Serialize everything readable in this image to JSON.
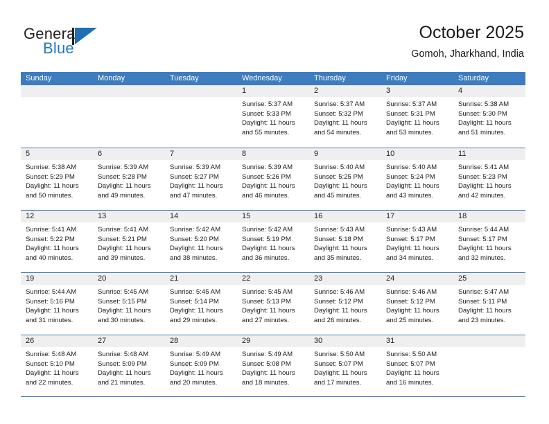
{
  "brand": {
    "name_part1": "General",
    "name_part2": "Blue",
    "flag_icon": "blue-flag-triangle"
  },
  "header": {
    "title": "October 2025",
    "subtitle": "Gomoh, Jharkhand, India"
  },
  "colors": {
    "header_blue": "#3d7cbf",
    "band_gray": "#efefef",
    "brand_blue": "#1f7ac4",
    "text_dark": "#1a1a1a"
  },
  "weekdays": [
    "Sunday",
    "Monday",
    "Tuesday",
    "Wednesday",
    "Thursday",
    "Friday",
    "Saturday"
  ],
  "labels": {
    "sunrise_prefix": "Sunrise: ",
    "sunset_prefix": "Sunset: ",
    "daylight_prefix": "Daylight: "
  },
  "weeks": [
    [
      {
        "day": "",
        "empty": true
      },
      {
        "day": "",
        "empty": true
      },
      {
        "day": "",
        "empty": true
      },
      {
        "day": "1",
        "sunrise": "Sunrise: 5:37 AM",
        "sunset": "Sunset: 5:33 PM",
        "daylight_l1": "Daylight: 11 hours",
        "daylight_l2": "and 55 minutes."
      },
      {
        "day": "2",
        "sunrise": "Sunrise: 5:37 AM",
        "sunset": "Sunset: 5:32 PM",
        "daylight_l1": "Daylight: 11 hours",
        "daylight_l2": "and 54 minutes."
      },
      {
        "day": "3",
        "sunrise": "Sunrise: 5:37 AM",
        "sunset": "Sunset: 5:31 PM",
        "daylight_l1": "Daylight: 11 hours",
        "daylight_l2": "and 53 minutes."
      },
      {
        "day": "4",
        "sunrise": "Sunrise: 5:38 AM",
        "sunset": "Sunset: 5:30 PM",
        "daylight_l1": "Daylight: 11 hours",
        "daylight_l2": "and 51 minutes."
      }
    ],
    [
      {
        "day": "5",
        "sunrise": "Sunrise: 5:38 AM",
        "sunset": "Sunset: 5:29 PM",
        "daylight_l1": "Daylight: 11 hours",
        "daylight_l2": "and 50 minutes."
      },
      {
        "day": "6",
        "sunrise": "Sunrise: 5:39 AM",
        "sunset": "Sunset: 5:28 PM",
        "daylight_l1": "Daylight: 11 hours",
        "daylight_l2": "and 49 minutes."
      },
      {
        "day": "7",
        "sunrise": "Sunrise: 5:39 AM",
        "sunset": "Sunset: 5:27 PM",
        "daylight_l1": "Daylight: 11 hours",
        "daylight_l2": "and 47 minutes."
      },
      {
        "day": "8",
        "sunrise": "Sunrise: 5:39 AM",
        "sunset": "Sunset: 5:26 PM",
        "daylight_l1": "Daylight: 11 hours",
        "daylight_l2": "and 46 minutes."
      },
      {
        "day": "9",
        "sunrise": "Sunrise: 5:40 AM",
        "sunset": "Sunset: 5:25 PM",
        "daylight_l1": "Daylight: 11 hours",
        "daylight_l2": "and 45 minutes."
      },
      {
        "day": "10",
        "sunrise": "Sunrise: 5:40 AM",
        "sunset": "Sunset: 5:24 PM",
        "daylight_l1": "Daylight: 11 hours",
        "daylight_l2": "and 43 minutes."
      },
      {
        "day": "11",
        "sunrise": "Sunrise: 5:41 AM",
        "sunset": "Sunset: 5:23 PM",
        "daylight_l1": "Daylight: 11 hours",
        "daylight_l2": "and 42 minutes."
      }
    ],
    [
      {
        "day": "12",
        "sunrise": "Sunrise: 5:41 AM",
        "sunset": "Sunset: 5:22 PM",
        "daylight_l1": "Daylight: 11 hours",
        "daylight_l2": "and 40 minutes."
      },
      {
        "day": "13",
        "sunrise": "Sunrise: 5:41 AM",
        "sunset": "Sunset: 5:21 PM",
        "daylight_l1": "Daylight: 11 hours",
        "daylight_l2": "and 39 minutes."
      },
      {
        "day": "14",
        "sunrise": "Sunrise: 5:42 AM",
        "sunset": "Sunset: 5:20 PM",
        "daylight_l1": "Daylight: 11 hours",
        "daylight_l2": "and 38 minutes."
      },
      {
        "day": "15",
        "sunrise": "Sunrise: 5:42 AM",
        "sunset": "Sunset: 5:19 PM",
        "daylight_l1": "Daylight: 11 hours",
        "daylight_l2": "and 36 minutes."
      },
      {
        "day": "16",
        "sunrise": "Sunrise: 5:43 AM",
        "sunset": "Sunset: 5:18 PM",
        "daylight_l1": "Daylight: 11 hours",
        "daylight_l2": "and 35 minutes."
      },
      {
        "day": "17",
        "sunrise": "Sunrise: 5:43 AM",
        "sunset": "Sunset: 5:17 PM",
        "daylight_l1": "Daylight: 11 hours",
        "daylight_l2": "and 34 minutes."
      },
      {
        "day": "18",
        "sunrise": "Sunrise: 5:44 AM",
        "sunset": "Sunset: 5:17 PM",
        "daylight_l1": "Daylight: 11 hours",
        "daylight_l2": "and 32 minutes."
      }
    ],
    [
      {
        "day": "19",
        "sunrise": "Sunrise: 5:44 AM",
        "sunset": "Sunset: 5:16 PM",
        "daylight_l1": "Daylight: 11 hours",
        "daylight_l2": "and 31 minutes."
      },
      {
        "day": "20",
        "sunrise": "Sunrise: 5:45 AM",
        "sunset": "Sunset: 5:15 PM",
        "daylight_l1": "Daylight: 11 hours",
        "daylight_l2": "and 30 minutes."
      },
      {
        "day": "21",
        "sunrise": "Sunrise: 5:45 AM",
        "sunset": "Sunset: 5:14 PM",
        "daylight_l1": "Daylight: 11 hours",
        "daylight_l2": "and 29 minutes."
      },
      {
        "day": "22",
        "sunrise": "Sunrise: 5:45 AM",
        "sunset": "Sunset: 5:13 PM",
        "daylight_l1": "Daylight: 11 hours",
        "daylight_l2": "and 27 minutes."
      },
      {
        "day": "23",
        "sunrise": "Sunrise: 5:46 AM",
        "sunset": "Sunset: 5:12 PM",
        "daylight_l1": "Daylight: 11 hours",
        "daylight_l2": "and 26 minutes."
      },
      {
        "day": "24",
        "sunrise": "Sunrise: 5:46 AM",
        "sunset": "Sunset: 5:12 PM",
        "daylight_l1": "Daylight: 11 hours",
        "daylight_l2": "and 25 minutes."
      },
      {
        "day": "25",
        "sunrise": "Sunrise: 5:47 AM",
        "sunset": "Sunset: 5:11 PM",
        "daylight_l1": "Daylight: 11 hours",
        "daylight_l2": "and 23 minutes."
      }
    ],
    [
      {
        "day": "26",
        "sunrise": "Sunrise: 5:48 AM",
        "sunset": "Sunset: 5:10 PM",
        "daylight_l1": "Daylight: 11 hours",
        "daylight_l2": "and 22 minutes."
      },
      {
        "day": "27",
        "sunrise": "Sunrise: 5:48 AM",
        "sunset": "Sunset: 5:09 PM",
        "daylight_l1": "Daylight: 11 hours",
        "daylight_l2": "and 21 minutes."
      },
      {
        "day": "28",
        "sunrise": "Sunrise: 5:49 AM",
        "sunset": "Sunset: 5:09 PM",
        "daylight_l1": "Daylight: 11 hours",
        "daylight_l2": "and 20 minutes."
      },
      {
        "day": "29",
        "sunrise": "Sunrise: 5:49 AM",
        "sunset": "Sunset: 5:08 PM",
        "daylight_l1": "Daylight: 11 hours",
        "daylight_l2": "and 18 minutes."
      },
      {
        "day": "30",
        "sunrise": "Sunrise: 5:50 AM",
        "sunset": "Sunset: 5:07 PM",
        "daylight_l1": "Daylight: 11 hours",
        "daylight_l2": "and 17 minutes."
      },
      {
        "day": "31",
        "sunrise": "Sunrise: 5:50 AM",
        "sunset": "Sunset: 5:07 PM",
        "daylight_l1": "Daylight: 11 hours",
        "daylight_l2": "and 16 minutes."
      },
      {
        "day": "",
        "empty": true
      }
    ]
  ]
}
